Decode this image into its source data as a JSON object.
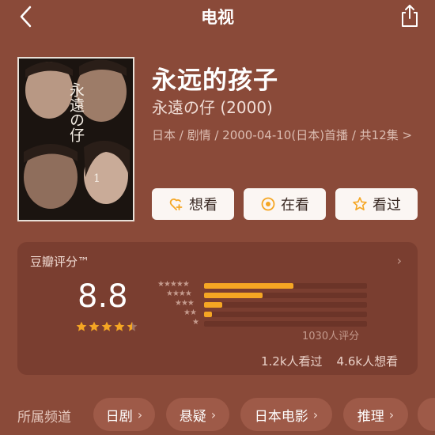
{
  "header": {
    "title": "电视",
    "back_icon": "chevron-left-icon",
    "share_icon": "share-icon"
  },
  "movie": {
    "title": "永远的孩子",
    "original_title": "永遠の仔 (2000)",
    "meta": "日本 / 剧情 / 2000-04-10(日本)首播 / 共12集 >",
    "poster_text": "永遠の仔",
    "poster_marker": "1"
  },
  "actions": [
    {
      "label": "想看",
      "icon": "heart-plus-icon"
    },
    {
      "label": "在看",
      "icon": "target-icon"
    },
    {
      "label": "看过",
      "icon": "star-outline-icon"
    }
  ],
  "rating": {
    "label": "豆瓣评分™",
    "score": "8.8",
    "stars_value": 4.5,
    "star_color": "#f5a623",
    "distribution": [
      {
        "stars": 5,
        "fraction": 0.55
      },
      {
        "stars": 4,
        "fraction": 0.36
      },
      {
        "stars": 3,
        "fraction": 0.11
      },
      {
        "stars": 2,
        "fraction": 0.05
      },
      {
        "stars": 1,
        "fraction": 0.0
      }
    ],
    "count_text": "1030人评分",
    "watched_text": "1.2k人看过",
    "want_text": "4.6k人想看"
  },
  "channels": {
    "label": "所属频道",
    "items": [
      "日剧",
      "悬疑",
      "日本电影",
      "推理"
    ]
  }
}
